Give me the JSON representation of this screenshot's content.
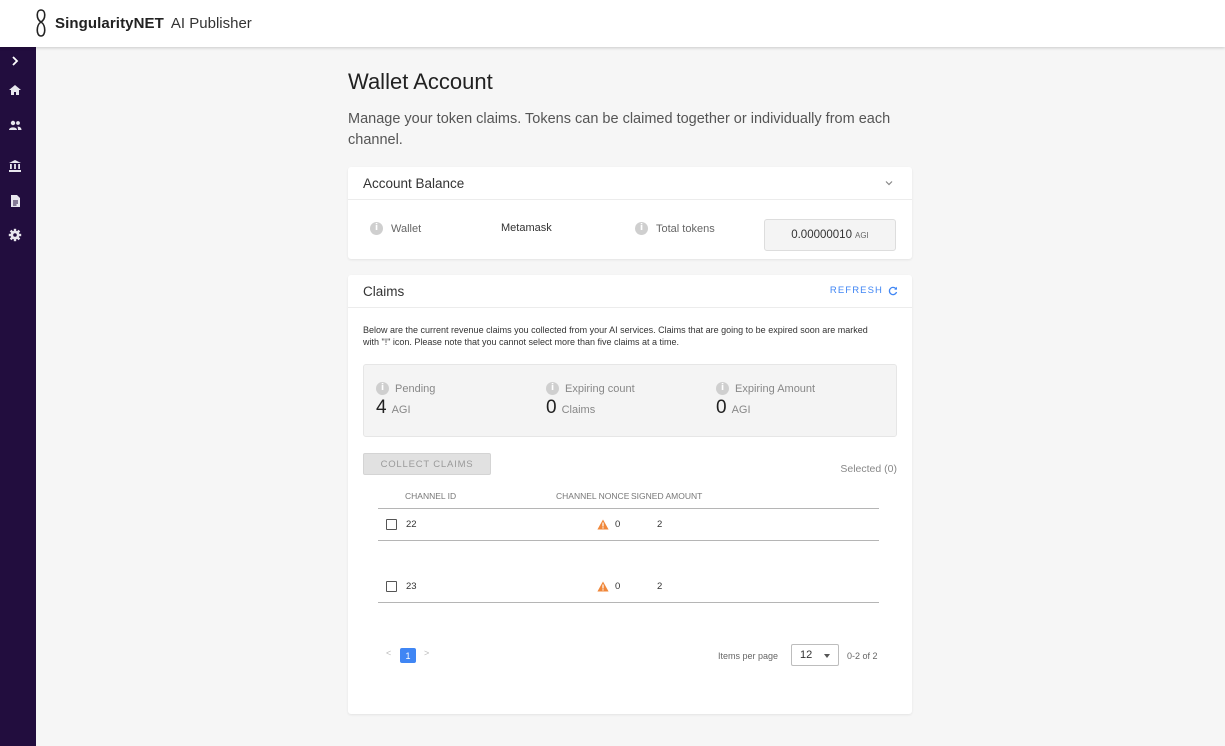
{
  "header": {
    "brand": "SingularityNET",
    "product": "AI Publisher",
    "logo_icon": "singularitynet-logo"
  },
  "sidebar": {
    "items": [
      {
        "icon": "chevron-right-icon",
        "label": ""
      },
      {
        "icon": "home-icon",
        "label": ""
      },
      {
        "icon": "team-icon",
        "label": ""
      },
      {
        "icon": "bank-icon",
        "label": ""
      },
      {
        "icon": "document-icon",
        "label": ""
      },
      {
        "icon": "gear-icon",
        "label": ""
      }
    ],
    "background": "#220d3e"
  },
  "page": {
    "title": "Wallet Account",
    "description": "Manage your token claims. Tokens can be claimed together or individually from each channel."
  },
  "balance": {
    "title": "Account Balance",
    "wallet_label": "Wallet",
    "wallet_value": "Metamask",
    "tokens_label": "Total tokens",
    "tokens_value": "0.00000010",
    "tokens_unit": "AGI"
  },
  "claims": {
    "title": "Claims",
    "refresh_label": "REFRESH",
    "description": "Below are the current revenue claims you collected from your AI services. Claims that are going to be expired soon are marked with \"!\" icon. Please note that you cannot select more than five claims at a time.",
    "stats": [
      {
        "label": "Pending",
        "value": "4",
        "unit": "AGI"
      },
      {
        "label": "Expiring count",
        "value": "0",
        "unit": "Claims"
      },
      {
        "label": "Expiring Amount",
        "value": "0",
        "unit": "AGI"
      }
    ],
    "collect_label": "COLLECT CLAIMS",
    "selected_label": "Selected (0)",
    "columns": {
      "channel_id": "CHANNEL ID",
      "channel_nonce": "CHANNEL NONCE",
      "signed_amount": "SIGNED AMOUNT"
    },
    "rows": [
      {
        "channel_id": "22",
        "nonce": "0",
        "amount": "2",
        "expiring": true
      },
      {
        "channel_id": "23",
        "nonce": "0",
        "amount": "2",
        "expiring": true
      }
    ],
    "pagination": {
      "prev": "<",
      "page": "1",
      "next": ">",
      "items_per_page_label": "Items per page",
      "items_per_page": "12",
      "range": "0-2 of 2"
    }
  },
  "colors": {
    "accent": "#4086f4",
    "warning": "#f0873a"
  }
}
